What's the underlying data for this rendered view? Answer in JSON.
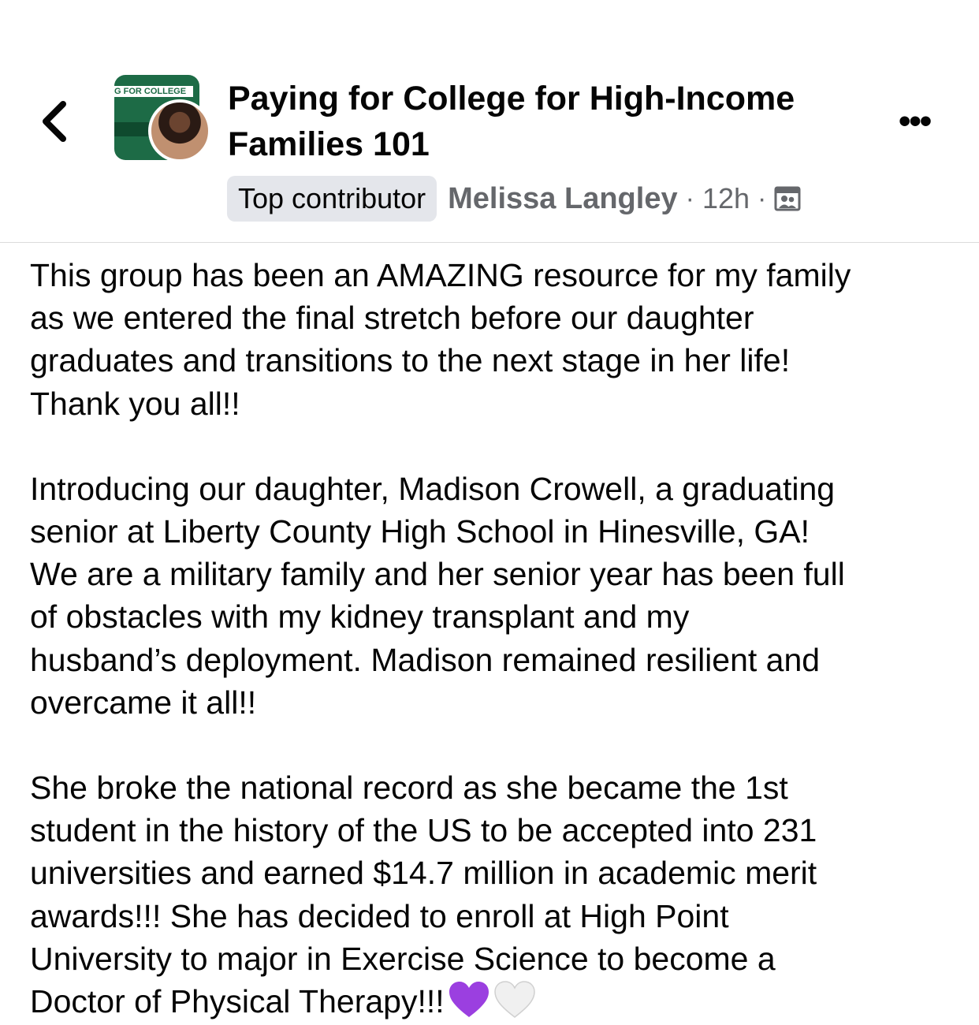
{
  "header": {
    "group_name": "Paying for College for High-Income Families 101",
    "group_cover_text": "G FOR COLLEGE",
    "badge": "Top contributor",
    "author": "Melissa Langley",
    "separator": "·",
    "time": "12h",
    "more_label": "•••"
  },
  "post": {
    "paragraphs": [
      "This group has been an AMAZING resource for my family\nas we entered the final stretch before our daughter\ngraduates and transitions to the next stage in her life!\nThank you all!!",
      "Introducing our daughter, Madison Crowell, a graduating\nsenior at Liberty County High School in Hinesville, GA!\nWe are a military family and her senior year has been full\nof obstacles with my kidney transplant and my\nhusband’s deployment.  Madison remained resilient and\novercame it all!!",
      "She broke the national record as she became the 1st\nstudent in the history of the US to be accepted into 231\nuniversities and earned $14.7 million in academic merit\nawards!!! She has decided to enroll at High Point\nUniversity to major in Exercise Science to become a\nDoctor of Physical Therapy!!!"
    ],
    "emojis": [
      "purple-heart",
      "white-heart"
    ]
  },
  "colors": {
    "text": "#050505",
    "meta": "#65676b",
    "badge_bg": "#e4e6eb",
    "purple_heart": "#9b3fe0",
    "white_heart": "#e6e6e6"
  }
}
